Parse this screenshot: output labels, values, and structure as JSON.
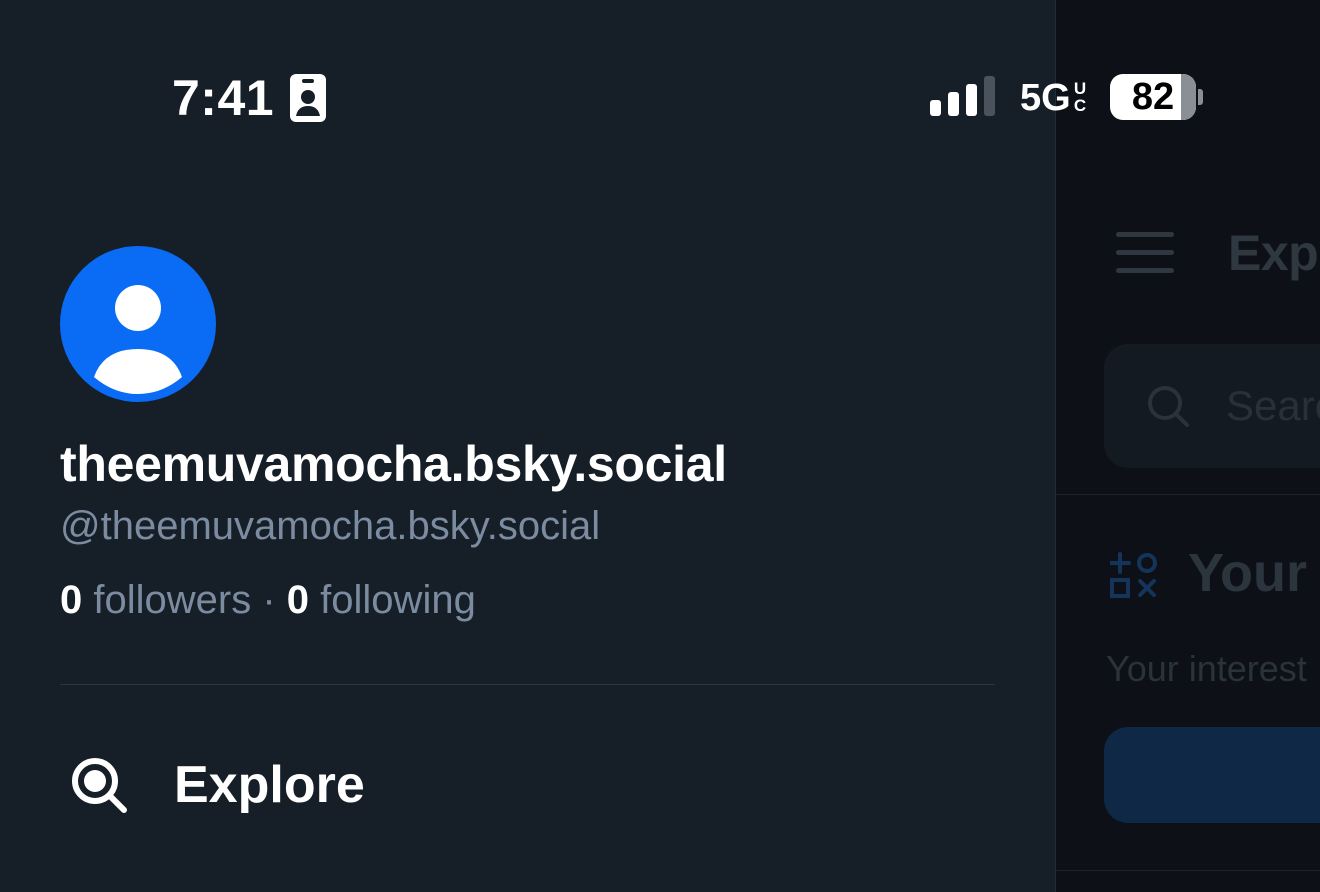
{
  "status_bar": {
    "time": "7:41",
    "network": "5G",
    "network_suffix": "UC",
    "battery_percent": 82
  },
  "profile": {
    "display_name": "theemuvamocha.bsky.social",
    "handle": "@theemuvamocha.bsky.social",
    "followers_count": "0",
    "followers_label": "followers",
    "separator": "·",
    "following_count": "0",
    "following_label": "following"
  },
  "nav": {
    "explore_label": "Explore"
  },
  "background_page": {
    "title": "Explo",
    "search_placeholder": "Searc",
    "interests_title": "Your",
    "interests_subtitle": "Your interest"
  },
  "icons": {
    "contact": "contact-card-icon",
    "signal": "cellular-signal-icon",
    "avatar": "default-avatar-icon",
    "explore": "search-icon",
    "menu": "hamburger-menu-icon",
    "interests": "interests-icon"
  },
  "colors": {
    "background": "#161e27",
    "avatar": "#0a6cf4",
    "muted_text": "#7b8ba0",
    "primary_text": "#ffffff"
  }
}
